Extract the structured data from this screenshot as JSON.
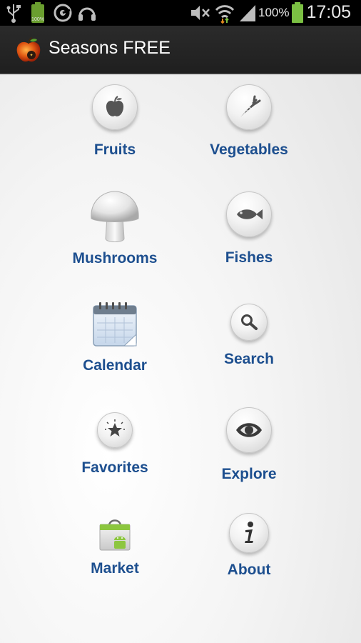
{
  "status_bar": {
    "battery_text": "100%",
    "time": "17:05",
    "icons": [
      "usb-icon",
      "battery-notification-icon",
      "sync-icon",
      "headset-icon",
      "mute-icon",
      "wifi-icon",
      "signal-icon",
      "battery-icon"
    ]
  },
  "action_bar": {
    "title": "Seasons FREE",
    "logo_icon": "apple-logo-icon"
  },
  "menu": {
    "fruits": "Fruits",
    "vegetables": "Vegetables",
    "mushrooms": "Mushrooms",
    "fishes": "Fishes",
    "calendar": "Calendar",
    "search": "Search",
    "favorites": "Favorites",
    "explore": "Explore",
    "market": "Market",
    "about": "About"
  },
  "colors": {
    "label": "#1d4f8f",
    "action_bar": "#232323",
    "status_bar": "#000000",
    "battery": "#7bc043"
  }
}
